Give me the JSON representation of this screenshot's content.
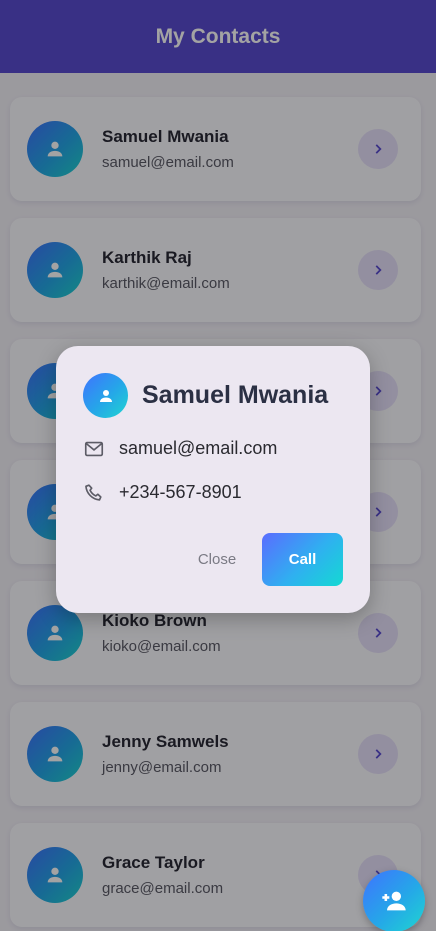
{
  "app_bar": {
    "title": "My Contacts"
  },
  "contacts": [
    {
      "name": "Samuel Mwania",
      "email": "samuel@email.com"
    },
    {
      "name": "Karthik Raj",
      "email": "karthik@email.com"
    },
    {
      "name": "",
      "email": ""
    },
    {
      "name": "",
      "email": ""
    },
    {
      "name": "Kioko Brown",
      "email": "kioko@email.com"
    },
    {
      "name": "Jenny Samwels",
      "email": "jenny@email.com"
    },
    {
      "name": "Grace Taylor",
      "email": "grace@email.com"
    }
  ],
  "dialog": {
    "name": "Samuel Mwania",
    "email": "samuel@email.com",
    "phone": "+234-567-8901",
    "close_label": "Close",
    "call_label": "Call"
  },
  "colors": {
    "primary": "#5a4bd0",
    "accent_start": "#3f73ff",
    "accent_end": "#1fd6d0"
  },
  "icons": {
    "avatar": "person-icon",
    "row_action": "chevron-right-icon",
    "email": "mail-icon",
    "phone": "phone-icon",
    "fab": "person-add-icon"
  }
}
